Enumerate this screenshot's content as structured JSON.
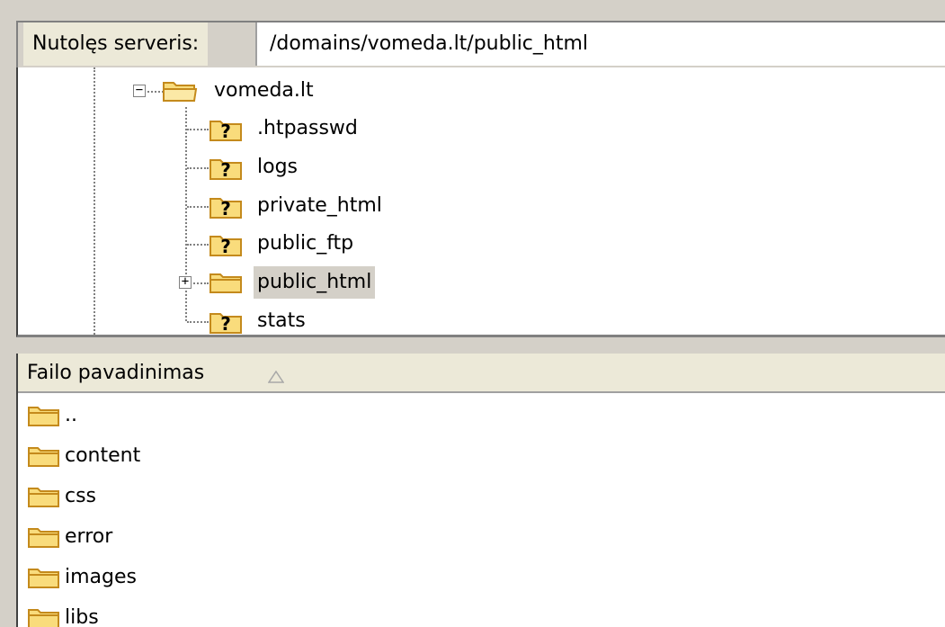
{
  "path_bar": {
    "label": "Nutolęs serveris:",
    "value": "/domains/vomeda.lt/public_html"
  },
  "tree": {
    "root": {
      "label": "vomeda.lt",
      "icon": "folder-open-icon",
      "expander": "−"
    },
    "children": [
      {
        "label": ".htpasswd",
        "icon": "folder-unknown-icon"
      },
      {
        "label": "logs",
        "icon": "folder-unknown-icon"
      },
      {
        "label": "private_html",
        "icon": "folder-unknown-icon"
      },
      {
        "label": "public_ftp",
        "icon": "folder-unknown-icon"
      },
      {
        "label": "public_html",
        "icon": "folder-icon",
        "expander": "+",
        "selected": true
      },
      {
        "label": "stats",
        "icon": "folder-unknown-icon"
      }
    ]
  },
  "file_list": {
    "column_header": "Failo pavadinimas",
    "sort_icon": "sort-ascending-icon",
    "rows": [
      {
        "name": "..",
        "icon": "folder-icon"
      },
      {
        "name": "content",
        "icon": "folder-icon"
      },
      {
        "name": "css",
        "icon": "folder-icon"
      },
      {
        "name": "error",
        "icon": "folder-icon"
      },
      {
        "name": "images",
        "icon": "folder-icon"
      },
      {
        "name": "libs",
        "icon": "folder-icon"
      }
    ]
  },
  "colors": {
    "folder_fill": "#f9dc7c",
    "folder_stroke": "#c48a1c",
    "window_bg": "#d4d0c8",
    "header_bg": "#ece9d8"
  }
}
